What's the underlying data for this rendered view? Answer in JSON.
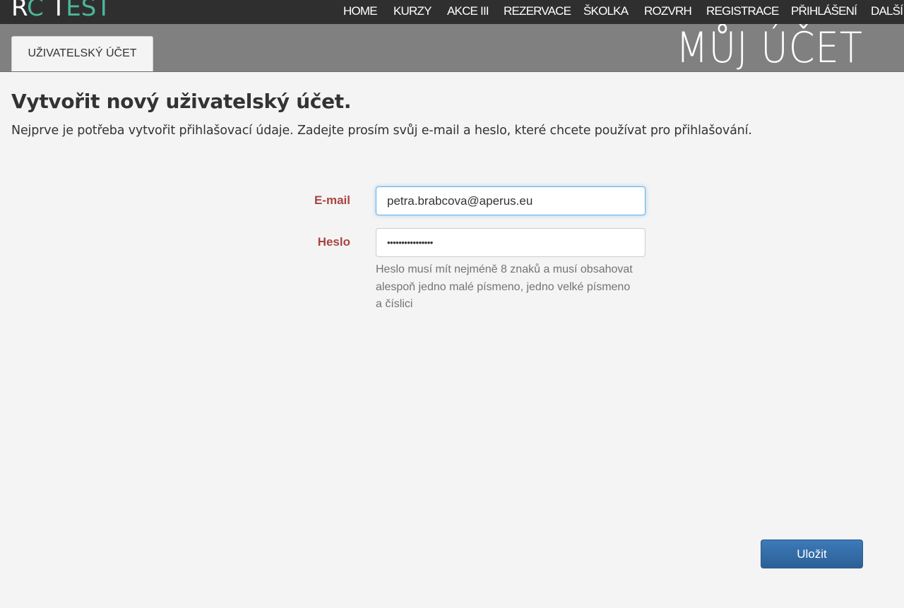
{
  "brand": {
    "logo_part1": "R",
    "logo_part2": "C",
    "logo_part3": " T",
    "logo_part4": "EST",
    "accent_color": "#4cb79a"
  },
  "nav": {
    "items": [
      {
        "label": "HOME"
      },
      {
        "label": "KURZY"
      },
      {
        "label": "AKCE III"
      },
      {
        "label": "REZERVACE"
      },
      {
        "label": "ŠKOLKA"
      },
      {
        "label": "ROZVRH"
      },
      {
        "label": "REGISTRACE"
      },
      {
        "label": "PŘIHLÁŠENÍ"
      },
      {
        "label": "DALŠÍ"
      }
    ]
  },
  "tabs": {
    "active": "UŽIVATELSKÝ ÚČET"
  },
  "page_heading": "MŮJ ÚČET",
  "main": {
    "title": "Vytvořit nový uživatelský účet.",
    "intro": "Nejprve je potřeba vytvořit přihlašovací údaje. Zadejte prosím svůj e-mail a heslo, které chcete používat pro přihlašování."
  },
  "form": {
    "email_label": "E-mail",
    "email_value": "petra.brabcova@aperus.eu",
    "password_label": "Heslo",
    "password_value": "••••••••••••••••",
    "password_help": "Heslo musí mít nejméně 8 znaků a musí obsahovat alespoň jedno malé písmeno, jedno velké písmeno a číslici",
    "label_color": "#a94442"
  },
  "actions": {
    "save_label": "Uložit",
    "button_color": "#2b6096"
  }
}
